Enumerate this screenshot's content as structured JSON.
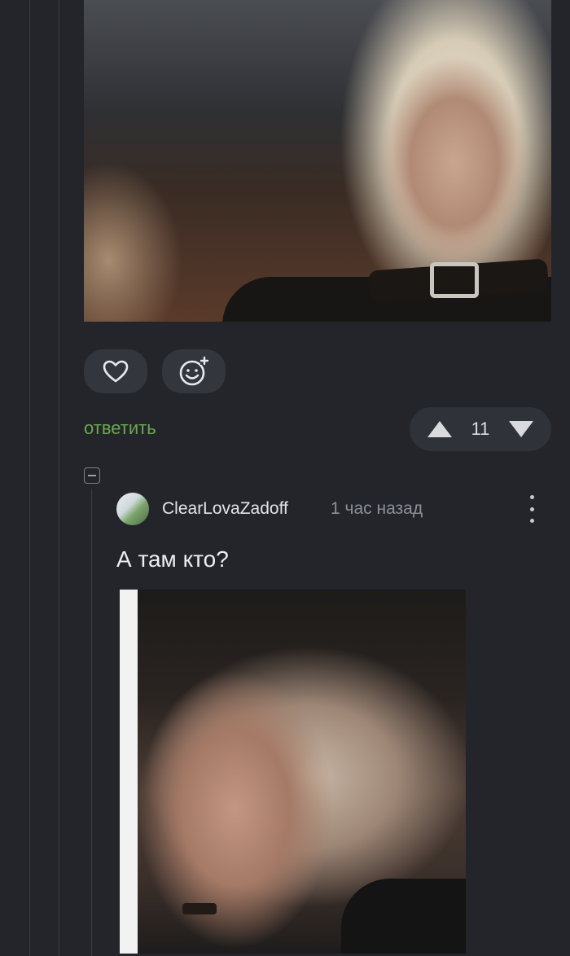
{
  "post": {
    "actions": {
      "like_icon": "heart-icon",
      "react_icon": "smiley-plus-icon"
    },
    "reply_label": "ответить",
    "vote": {
      "count": "11",
      "up_icon": "triangle-up-icon",
      "down_icon": "triangle-down-icon"
    }
  },
  "comment": {
    "username": "ClearLovaZadoff",
    "time": "1 час назад",
    "text": "А там кто?",
    "collapse_icon": "minus-square-icon",
    "more_icon": "more-vertical-icon"
  },
  "colors": {
    "background": "#23252b",
    "button": "#33363c",
    "accent_green": "#6aa84f",
    "muted_text": "#8d9098"
  }
}
